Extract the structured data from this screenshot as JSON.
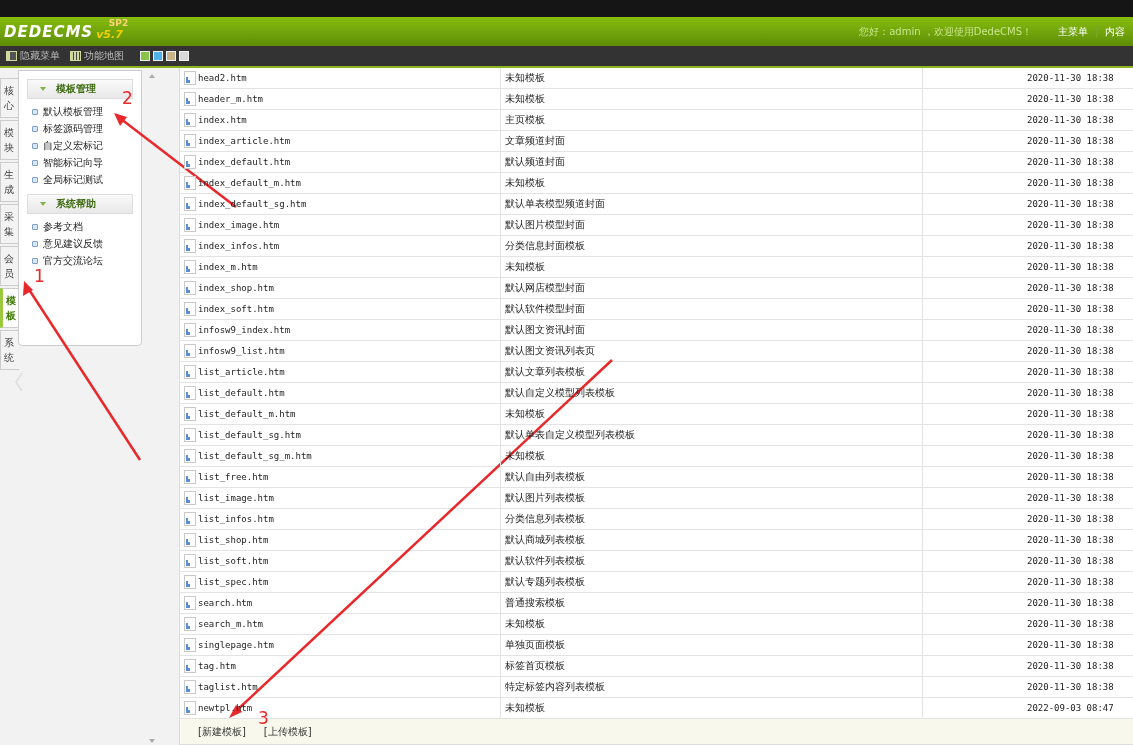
{
  "header": {
    "logo": "DEDECMS",
    "version": "v5.7",
    "edition": "SP2",
    "welcome": "您好：admin ，欢迎使用DedeCMS！",
    "nav": [
      "主菜单",
      "内容"
    ]
  },
  "toolbar": {
    "buttons": [
      "隐藏菜单",
      "功能地图"
    ],
    "skins": [
      {
        "color": "#8bc34a"
      },
      {
        "color": "#4fb3e8"
      },
      {
        "color": "#c8b48a"
      },
      {
        "color": "#d8d8d8"
      }
    ]
  },
  "side_tabs": [
    {
      "label": "核心",
      "selected": false
    },
    {
      "label": "模块",
      "selected": false
    },
    {
      "label": "生成",
      "selected": false
    },
    {
      "label": "采集",
      "selected": false
    },
    {
      "label": "会员",
      "selected": false
    },
    {
      "label": "模板",
      "selected": true
    },
    {
      "label": "系统",
      "selected": false
    }
  ],
  "sidebar": {
    "groups": [
      {
        "title": "模板管理",
        "expanded": true,
        "items": [
          "默认模板管理",
          "标签源码管理",
          "自定义宏标记",
          "智能标记向导",
          "全局标记测试"
        ]
      },
      {
        "title": "系统帮助",
        "expanded": true,
        "items": [
          "参考文档",
          "意见建议反馈",
          "官方交流论坛"
        ]
      }
    ]
  },
  "table": {
    "rows": [
      {
        "file": "head2.htm",
        "description": "未知模板",
        "modified": "2020-11-30 18:38"
      },
      {
        "file": "header_m.htm",
        "description": "未知模板",
        "modified": "2020-11-30 18:38"
      },
      {
        "file": "index.htm",
        "description": "主页模板",
        "modified": "2020-11-30 18:38"
      },
      {
        "file": "index_article.htm",
        "description": "文章频道封面",
        "modified": "2020-11-30 18:38"
      },
      {
        "file": "index_default.htm",
        "description": "默认频道封面",
        "modified": "2020-11-30 18:38"
      },
      {
        "file": "index_default_m.htm",
        "description": "未知模板",
        "modified": "2020-11-30 18:38"
      },
      {
        "file": "index_default_sg.htm",
        "description": "默认单表模型频道封面",
        "modified": "2020-11-30 18:38"
      },
      {
        "file": "index_image.htm",
        "description": "默认图片模型封面",
        "modified": "2020-11-30 18:38"
      },
      {
        "file": "index_infos.htm",
        "description": "分类信息封面模板",
        "modified": "2020-11-30 18:38"
      },
      {
        "file": "index_m.htm",
        "description": "未知模板",
        "modified": "2020-11-30 18:38"
      },
      {
        "file": "index_shop.htm",
        "description": "默认网店模型封面",
        "modified": "2020-11-30 18:38"
      },
      {
        "file": "index_soft.htm",
        "description": "默认软件模型封面",
        "modified": "2020-11-30 18:38"
      },
      {
        "file": "infosw9_index.htm",
        "description": "默认图文资讯封面",
        "modified": "2020-11-30 18:38"
      },
      {
        "file": "infosw9_list.htm",
        "description": "默认图文资讯列表页",
        "modified": "2020-11-30 18:38"
      },
      {
        "file": "list_article.htm",
        "description": "默认文章列表模板",
        "modified": "2020-11-30 18:38"
      },
      {
        "file": "list_default.htm",
        "description": "默认自定义模型列表模板",
        "modified": "2020-11-30 18:38"
      },
      {
        "file": "list_default_m.htm",
        "description": "未知模板",
        "modified": "2020-11-30 18:38"
      },
      {
        "file": "list_default_sg.htm",
        "description": "默认单表自定义模型列表模板",
        "modified": "2020-11-30 18:38"
      },
      {
        "file": "list_default_sg_m.htm",
        "description": "未知模板",
        "modified": "2020-11-30 18:38"
      },
      {
        "file": "list_free.htm",
        "description": "默认自由列表模板",
        "modified": "2020-11-30 18:38"
      },
      {
        "file": "list_image.htm",
        "description": "默认图片列表模板",
        "modified": "2020-11-30 18:38"
      },
      {
        "file": "list_infos.htm",
        "description": "分类信息列表模板",
        "modified": "2020-11-30 18:38"
      },
      {
        "file": "list_shop.htm",
        "description": "默认商城列表模板",
        "modified": "2020-11-30 18:38"
      },
      {
        "file": "list_soft.htm",
        "description": "默认软件列表模板",
        "modified": "2020-11-30 18:38"
      },
      {
        "file": "list_spec.htm",
        "description": "默认专题列表模板",
        "modified": "2020-11-30 18:38"
      },
      {
        "file": "search.htm",
        "description": "普通搜索模板",
        "modified": "2020-11-30 18:38"
      },
      {
        "file": "search_m.htm",
        "description": "未知模板",
        "modified": "2020-11-30 18:38"
      },
      {
        "file": "singlepage.htm",
        "description": "单独页面模板",
        "modified": "2020-11-30 18:38"
      },
      {
        "file": "tag.htm",
        "description": "标签首页模板",
        "modified": "2020-11-30 18:38"
      },
      {
        "file": "taglist.htm",
        "description": "特定标签内容列表模板",
        "modified": "2020-11-30 18:38"
      },
      {
        "file": "newtpl.htm",
        "description": "未知模板",
        "modified": "2022-09-03 08:47"
      }
    ],
    "actions": [
      "[新建模板]",
      "[上传模板]"
    ]
  },
  "annotations": [
    {
      "label": "1"
    },
    {
      "label": "2"
    },
    {
      "label": "3"
    }
  ]
}
